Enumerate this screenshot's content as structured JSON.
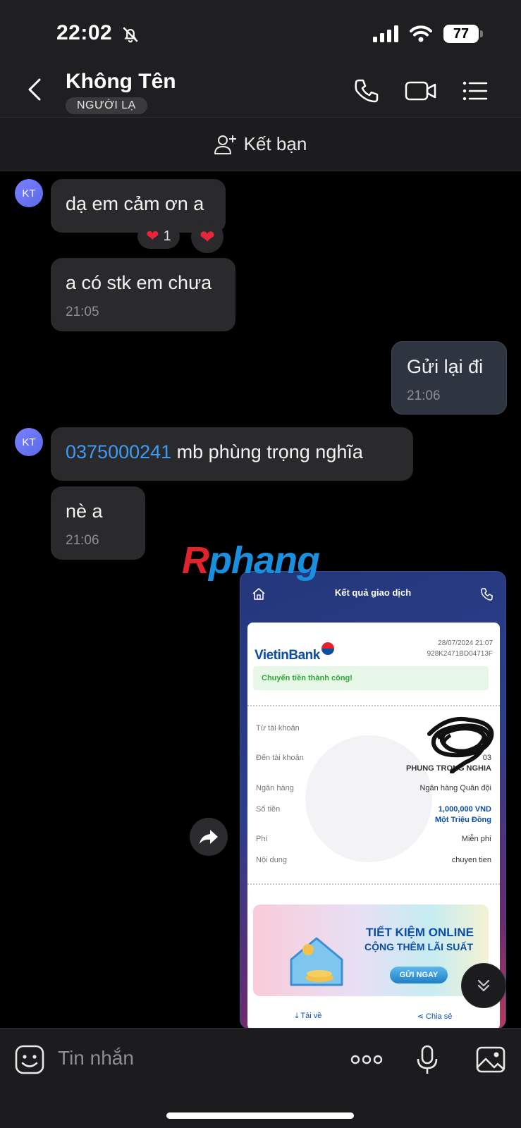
{
  "status_bar": {
    "time": "22:02",
    "battery": "77"
  },
  "header": {
    "contact_name": "Không Tên",
    "badge": "NGƯỜI LẠ"
  },
  "add_friend": {
    "label": "Kết bạn"
  },
  "messages": {
    "m1": {
      "avatar": "KT",
      "text": "dạ em cảm ơn a",
      "reaction_count": "1"
    },
    "m2": {
      "text": "a có stk em chưa",
      "time": "21:05"
    },
    "m3": {
      "text": "Gửi lại đi",
      "time": "21:06"
    },
    "m4": {
      "avatar": "KT",
      "link": "0375000241",
      "text": " mb phùng trọng nghĩa"
    },
    "m5": {
      "text": "nè a",
      "time": "21:06"
    }
  },
  "watermark": {
    "first": "R",
    "rest": "phang"
  },
  "receipt": {
    "title": "Kết quả giao dịch",
    "bank": "VietinBank",
    "datetime": "28/07/2024 21:07",
    "code": "928K2471BD04713F",
    "status": "Chuyển tiền thành công!",
    "rows": [
      {
        "label": "Từ tài khoản",
        "value": ""
      },
      {
        "label": "Đến tài khoản",
        "value": "03",
        "value2": "PHUNG TRONG NGHIA"
      },
      {
        "label": "Ngân hàng",
        "value": "Ngân hàng Quân đội"
      },
      {
        "label": "Số tiền",
        "value": "1,000,000 VND",
        "value2": "Một Triệu Đồng"
      },
      {
        "label": "Phí",
        "value": "Miễn phí"
      },
      {
        "label": "Nội dung",
        "value": "chuyen tien"
      }
    ],
    "banner": {
      "line1": "TIẾT KIỆM ONLINE",
      "line2": "CỘNG THÊM LÃI SUẤT",
      "button": "GỬI NGAY"
    },
    "actions": {
      "download": "Tải về",
      "share": "Chia sẻ"
    }
  },
  "composer": {
    "placeholder": "Tin nhắn"
  },
  "colors": {
    "link": "#3d9bf5",
    "bubble_in": "#2a2a2c",
    "bubble_out": "#2e3440",
    "heart": "#e8253a"
  }
}
